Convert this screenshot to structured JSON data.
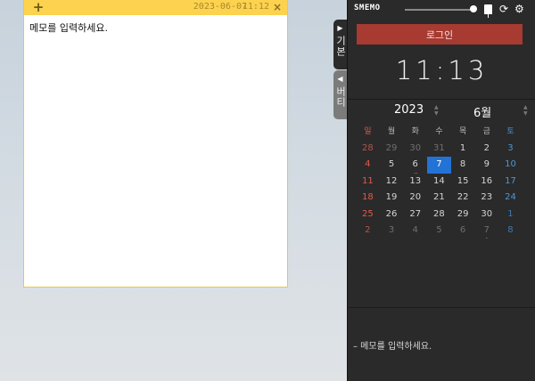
{
  "note": {
    "add_label": "+",
    "date": "2023-06-07",
    "time": "11:12",
    "close_label": "×",
    "text": "메모를 입력하세요."
  },
  "side_tabs": {
    "basic": {
      "arrow": "▶",
      "label": "기본"
    },
    "vertical": {
      "arrow": "◀",
      "label": "버티"
    }
  },
  "panel": {
    "logo": "SMEMO",
    "login_label": "로그인",
    "clock": "11:13",
    "memo_hint": "– 메모를 입력하세요.",
    "icons": {
      "pin": "pin-icon",
      "sync": "sync-icon",
      "settings": "gear-icon"
    },
    "colors": {
      "login": "#a73a31",
      "today": "#2372d6",
      "sunday": "#e25a4c",
      "saturday": "#4a97d8"
    }
  },
  "calendar": {
    "year": "2023",
    "month": "6월",
    "weekdays": [
      "일",
      "월",
      "화",
      "수",
      "목",
      "금",
      "토"
    ],
    "weeks": [
      [
        "28",
        "29",
        "30",
        "31",
        "1",
        "2",
        "3"
      ],
      [
        "4",
        "5",
        "6",
        "7",
        "8",
        "9",
        "10"
      ],
      [
        "11",
        "12",
        "13",
        "14",
        "15",
        "16",
        "17"
      ],
      [
        "18",
        "19",
        "20",
        "21",
        "22",
        "23",
        "24"
      ],
      [
        "25",
        "26",
        "27",
        "28",
        "29",
        "30",
        "1"
      ],
      [
        "2",
        "3",
        "4",
        "5",
        "6",
        "7",
        "8"
      ]
    ],
    "selected_day": "7"
  }
}
